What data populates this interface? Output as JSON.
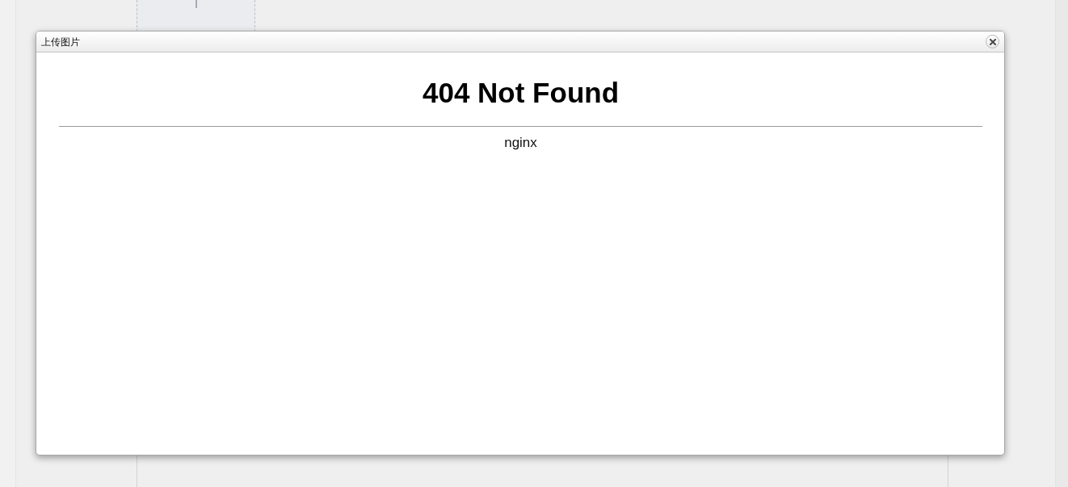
{
  "dialog": {
    "title": "上传图片",
    "page": {
      "heading": "404 Not Found",
      "server": "nginx"
    }
  }
}
